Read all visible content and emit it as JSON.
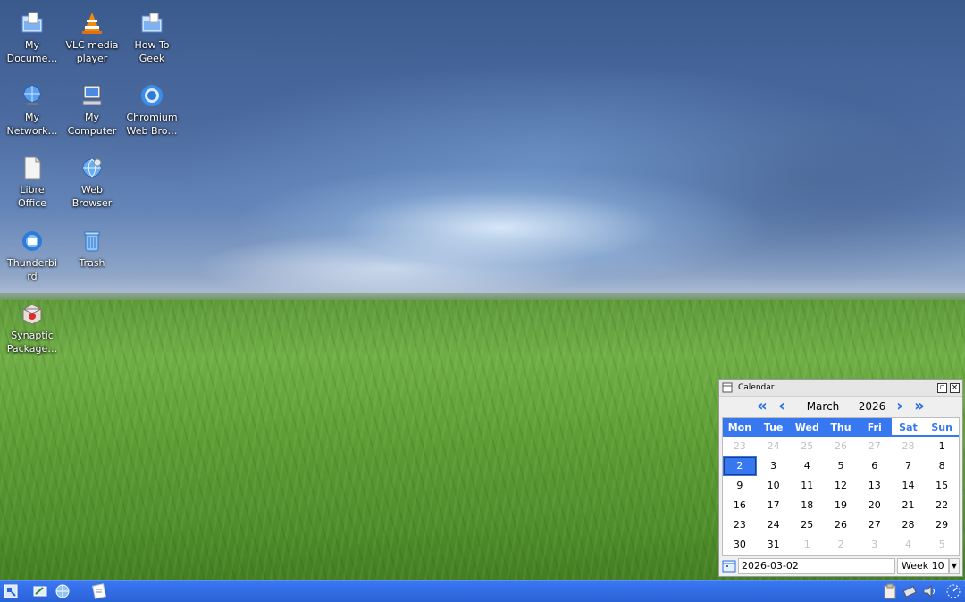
{
  "desktop": {
    "icons": [
      {
        "label": "My\nDocume…",
        "icon": "folder-documents-icon"
      },
      {
        "label": "VLC media\nplayer",
        "icon": "vlc-cone-icon"
      },
      {
        "label": "How To\nGeek",
        "icon": "folder-icon"
      },
      {
        "label": "My\nNetwork…",
        "icon": "network-globe-icon"
      },
      {
        "label": "My\nComputer",
        "icon": "computer-icon"
      },
      {
        "label": "Chromium\nWeb Bro…",
        "icon": "chromium-icon"
      },
      {
        "label": "Libre\nOffice",
        "icon": "document-icon"
      },
      {
        "label": "Web\nBrowser",
        "icon": "web-browser-icon"
      },
      {
        "label": "Thunderbi\nrd",
        "icon": "thunderbird-icon"
      },
      {
        "label": "Trash",
        "icon": "trash-icon"
      },
      {
        "label": "Synaptic\nPackage…",
        "icon": "package-icon"
      }
    ]
  },
  "calendar": {
    "title": "Calendar",
    "month": "March",
    "year": "2026",
    "weekdays": [
      "Mon",
      "Tue",
      "Wed",
      "Thu",
      "Fri",
      "Sat",
      "Sun"
    ],
    "weeks": [
      [
        "23",
        "24",
        "25",
        "26",
        "27",
        "28",
        "1"
      ],
      [
        "2",
        "3",
        "4",
        "5",
        "6",
        "7",
        "8"
      ],
      [
        "9",
        "10",
        "11",
        "12",
        "13",
        "14",
        "15"
      ],
      [
        "16",
        "17",
        "18",
        "19",
        "20",
        "21",
        "22"
      ],
      [
        "23",
        "24",
        "25",
        "26",
        "27",
        "28",
        "29"
      ],
      [
        "30",
        "31",
        "1",
        "2",
        "3",
        "4",
        "5"
      ]
    ],
    "selected_date": "2026-03-02",
    "week_label": "Week 10",
    "accent_color": "#3778f0"
  },
  "taskbar": {
    "color": "#2f6ae0",
    "left_icons": [
      "start-menu-icon",
      "file-manager-icon",
      "web-browser-icon",
      "text-editor-icon"
    ],
    "tray_icons": [
      "clipboard-icon",
      "network-tray-icon",
      "volume-icon",
      "clock-icon"
    ]
  }
}
